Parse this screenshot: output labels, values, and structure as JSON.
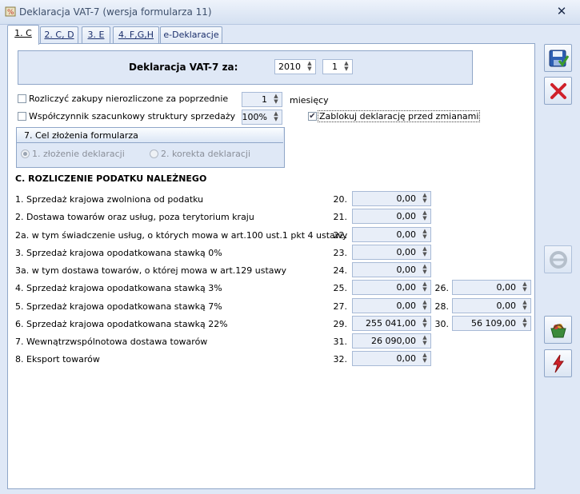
{
  "window": {
    "title": "Deklaracja VAT-7 (wersja formularza 11)"
  },
  "tabs": [
    {
      "label": "1. C"
    },
    {
      "label": "2. C, D"
    },
    {
      "label": "3. E"
    },
    {
      "label": "4. F,G,H"
    },
    {
      "label": "e-Deklaracje"
    }
  ],
  "header": {
    "label": "Deklaracja VAT-7 za:",
    "year": "2010",
    "month": "1"
  },
  "options": {
    "settle_label": "Rozliczyć zakupy nierozliczone za poprzednie",
    "settle_value": "1",
    "settle_unit": "miesięcy",
    "settle_checked": false,
    "coef_label": "Współczynnik szacunkowy struktury sprzedaży",
    "coef_value": "100%",
    "coef_checked": false,
    "lock_label": "Zablokuj deklarację przed zmianami",
    "lock_checked": true
  },
  "purpose": {
    "title": "7. Cel złożenia formularza",
    "option1": "1. złożenie deklaracji",
    "option2": "2. korekta deklaracji",
    "selected": 1
  },
  "section_c": {
    "title": "C. ROZLICZENIE PODATKU NALEŻNEGO",
    "rows": [
      {
        "label": "1. Sprzedaż krajowa zwolniona od podatku",
        "num": "20.",
        "value": "0,00"
      },
      {
        "label": "2. Dostawa towarów oraz usług, poza terytorium kraju",
        "num": "21.",
        "value": "0,00"
      },
      {
        "label": "2a. w tym świadczenie usług, o których mowa w art.100 ust.1 pkt 4 ustawy",
        "num": "22.",
        "value": "0,00"
      },
      {
        "label": "3. Sprzedaż krajowa opodatkowana stawką 0%",
        "num": "23.",
        "value": "0,00"
      },
      {
        "label": "3a. w tym dostawa towarów, o której mowa w art.129 ustawy",
        "num": "24.",
        "value": "0,00"
      },
      {
        "label": "4. Sprzedaż krajowa opodatkowana stawką 3%",
        "num": "25.",
        "value": "0,00",
        "num2": "26.",
        "value2": "0,00"
      },
      {
        "label": "5. Sprzedaż krajowa opodatkowana stawką 7%",
        "num": "27.",
        "value": "0,00",
        "num2": "28.",
        "value2": "0,00"
      },
      {
        "label": "6. Sprzedaż krajowa opodatkowana stawką 22%",
        "num": "29.",
        "value": "255 041,00",
        "num2": "30.",
        "value2": "56 109,00"
      },
      {
        "label": "7. Wewnątrzwspólnotowa dostawa towarów",
        "num": "31.",
        "value": "26 090,00"
      },
      {
        "label": "8. Eksport towarów",
        "num": "32.",
        "value": "0,00"
      }
    ]
  },
  "toolbar": {
    "icons": [
      "save-icon",
      "cancel-icon",
      "e-declaration-icon",
      "basket-icon",
      "lightning-icon"
    ]
  },
  "colors": {
    "window_bg": "#dfe8f6",
    "accent": "#8fa6c8",
    "cancel_red": "#d0202a"
  }
}
